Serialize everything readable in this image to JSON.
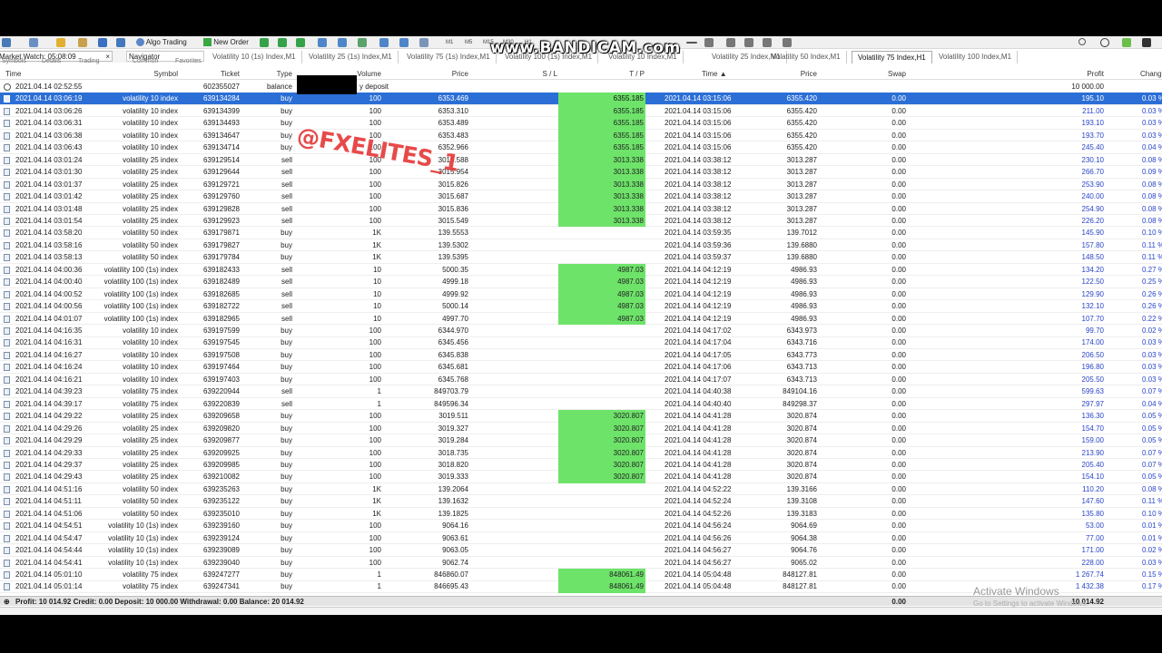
{
  "watermark": "www.BANDICAM.com",
  "toolbar": {
    "algo": "Algo Trading",
    "neworder": "New Order",
    "timeframes": [
      "M1",
      "M5",
      "M15",
      "M30",
      "H1",
      "H4"
    ]
  },
  "panel": {
    "market_watch": "Market Watch: 05:08:09",
    "navigator": "Navigator",
    "tab_symbols": "Symbols",
    "tab_details": "Details",
    "tab_trading": "Trading",
    "tab_common": "Common",
    "tab_favorites": "Favorites"
  },
  "chart_tabs": [
    "Volatility 10 (1s) Index,M1",
    "Volatility 25 (1s) Index,M1",
    "Volatility 75 (1s) Index,M1",
    "Volatility 100 (1s) Index,M1",
    "Volatility 10 Index,M1",
    "Volatility 25 Index,M1",
    "Volatility 50 Index,M1",
    "Volatility 75 Index,H1",
    "Volatility 100 Index,M1"
  ],
  "active_tab": 7,
  "columns": {
    "time": "Time",
    "symbol": "Symbol",
    "ticket": "Ticket",
    "type": "Type",
    "volume": "Volume",
    "price": "Price",
    "sl": "S / L",
    "tp": "T / P",
    "time2": "Time",
    "price2": "Price",
    "swap": "Swap",
    "profit": "Profit",
    "change": "Chang"
  },
  "balance_row": {
    "time": "2021.04.14 02:52:55",
    "ticket": "602355027",
    "type": "balance",
    "comment": "y deposit",
    "profit": "10 000.00"
  },
  "rows": [
    [
      "2021.04.14 03:06:19",
      "volatility 10 index",
      "639134284",
      "buy",
      "100",
      "6353.469",
      "",
      "6355.185",
      "2021.04.14 03:15:06",
      "6355.420",
      "0.00",
      "195.10",
      "0.03 %"
    ],
    [
      "2021.04.14 03:06:26",
      "volatility 10 index",
      "639134399",
      "buy",
      "100",
      "6353.310",
      "",
      "6355.185",
      "2021.04.14 03:15:06",
      "6355.420",
      "0.00",
      "211.00",
      "0.03 %"
    ],
    [
      "2021.04.14 03:06:31",
      "volatility 10 index",
      "639134493",
      "buy",
      "100",
      "6353.489",
      "",
      "6355.185",
      "2021.04.14 03:15:06",
      "6355.420",
      "0.00",
      "193.10",
      "0.03 %"
    ],
    [
      "2021.04.14 03:06:38",
      "volatility 10 index",
      "639134647",
      "buy",
      "100",
      "6353.483",
      "",
      "6355.185",
      "2021.04.14 03:15:06",
      "6355.420",
      "0.00",
      "193.70",
      "0.03 %"
    ],
    [
      "2021.04.14 03:06:43",
      "volatility 10 index",
      "639134714",
      "buy",
      "100",
      "6352.966",
      "",
      "6355.185",
      "2021.04.14 03:15:06",
      "6355.420",
      "0.00",
      "245.40",
      "0.04 %"
    ],
    [
      "2021.04.14 03:01:24",
      "volatility 25 index",
      "639129514",
      "sell",
      "100",
      "3015.588",
      "",
      "3013.338",
      "2021.04.14 03:38:12",
      "3013.287",
      "0.00",
      "230.10",
      "0.08 %"
    ],
    [
      "2021.04.14 03:01:30",
      "volatility 25 index",
      "639129644",
      "sell",
      "100",
      "3015.954",
      "",
      "3013.338",
      "2021.04.14 03:38:12",
      "3013.287",
      "0.00",
      "266.70",
      "0.09 %"
    ],
    [
      "2021.04.14 03:01:37",
      "volatility 25 index",
      "639129721",
      "sell",
      "100",
      "3015.826",
      "",
      "3013.338",
      "2021.04.14 03:38:12",
      "3013.287",
      "0.00",
      "253.90",
      "0.08 %"
    ],
    [
      "2021.04.14 03:01:42",
      "volatility 25 index",
      "639129760",
      "sell",
      "100",
      "3015.687",
      "",
      "3013.338",
      "2021.04.14 03:38:12",
      "3013.287",
      "0.00",
      "240.00",
      "0.08 %"
    ],
    [
      "2021.04.14 03:01:48",
      "volatility 25 index",
      "639129828",
      "sell",
      "100",
      "3015.836",
      "",
      "3013.338",
      "2021.04.14 03:38:12",
      "3013.287",
      "0.00",
      "254.90",
      "0.08 %"
    ],
    [
      "2021.04.14 03:01:54",
      "volatility 25 index",
      "639129923",
      "sell",
      "100",
      "3015.549",
      "",
      "3013.338",
      "2021.04.14 03:38:12",
      "3013.287",
      "0.00",
      "226.20",
      "0.08 %"
    ],
    [
      "2021.04.14 03:58:20",
      "volatility 50 index",
      "639179871",
      "buy",
      "1K",
      "139.5553",
      "",
      "",
      "2021.04.14 03:59:35",
      "139.7012",
      "0.00",
      "145.90",
      "0.10 %"
    ],
    [
      "2021.04.14 03:58:16",
      "volatility 50 index",
      "639179827",
      "buy",
      "1K",
      "139.5302",
      "",
      "",
      "2021.04.14 03:59:36",
      "139.6880",
      "0.00",
      "157.80",
      "0.11 %"
    ],
    [
      "2021.04.14 03:58:13",
      "volatility 50 index",
      "639179784",
      "buy",
      "1K",
      "139.5395",
      "",
      "",
      "2021.04.14 03:59:37",
      "139.6880",
      "0.00",
      "148.50",
      "0.11 %"
    ],
    [
      "2021.04.14 04:00:36",
      "volatility 100 (1s) index",
      "639182433",
      "sell",
      "10",
      "5000.35",
      "",
      "4987.03",
      "2021.04.14 04:12:19",
      "4986.93",
      "0.00",
      "134.20",
      "0.27 %"
    ],
    [
      "2021.04.14 04:00:40",
      "volatility 100 (1s) index",
      "639182489",
      "sell",
      "10",
      "4999.18",
      "",
      "4987.03",
      "2021.04.14 04:12:19",
      "4986.93",
      "0.00",
      "122.50",
      "0.25 %"
    ],
    [
      "2021.04.14 04:00:52",
      "volatility 100 (1s) index",
      "639182685",
      "sell",
      "10",
      "4999.92",
      "",
      "4987.03",
      "2021.04.14 04:12:19",
      "4986.93",
      "0.00",
      "129.90",
      "0.26 %"
    ],
    [
      "2021.04.14 04:00:56",
      "volatility 100 (1s) index",
      "639182722",
      "sell",
      "10",
      "5000.14",
      "",
      "4987.03",
      "2021.04.14 04:12:19",
      "4986.93",
      "0.00",
      "132.10",
      "0.26 %"
    ],
    [
      "2021.04.14 04:01:07",
      "volatility 100 (1s) index",
      "639182965",
      "sell",
      "10",
      "4997.70",
      "",
      "4987.03",
      "2021.04.14 04:12:19",
      "4986.93",
      "0.00",
      "107.70",
      "0.22 %"
    ],
    [
      "2021.04.14 04:16:35",
      "volatility 10 index",
      "639197599",
      "buy",
      "100",
      "6344.970",
      "",
      "",
      "2021.04.14 04:17:02",
      "6343.973",
      "0.00",
      "99.70",
      "0.02 %"
    ],
    [
      "2021.04.14 04:16:31",
      "volatility 10 index",
      "639197545",
      "buy",
      "100",
      "6345.456",
      "",
      "",
      "2021.04.14 04:17:04",
      "6343.716",
      "0.00",
      "174.00",
      "0.03 %"
    ],
    [
      "2021.04.14 04:16:27",
      "volatility 10 index",
      "639197508",
      "buy",
      "100",
      "6345.838",
      "",
      "",
      "2021.04.14 04:17:05",
      "6343.773",
      "0.00",
      "206.50",
      "0.03 %"
    ],
    [
      "2021.04.14 04:16:24",
      "volatility 10 index",
      "639197464",
      "buy",
      "100",
      "6345.681",
      "",
      "",
      "2021.04.14 04:17:06",
      "6343.713",
      "0.00",
      "196.80",
      "0.03 %"
    ],
    [
      "2021.04.14 04:16:21",
      "volatility 10 index",
      "639197403",
      "buy",
      "100",
      "6345.768",
      "",
      "",
      "2021.04.14 04:17:07",
      "6343.713",
      "0.00",
      "205.50",
      "0.03 %"
    ],
    [
      "2021.04.14 04:39:23",
      "volatility 75 index",
      "639220944",
      "sell",
      "1",
      "849703.79",
      "",
      "",
      "2021.04.14 04:40:38",
      "849104.16",
      "0.00",
      "599.63",
      "0.07 %"
    ],
    [
      "2021.04.14 04:39:17",
      "volatility 75 index",
      "639220839",
      "sell",
      "1",
      "849596.34",
      "",
      "",
      "2021.04.14 04:40:40",
      "849298.37",
      "0.00",
      "297.97",
      "0.04 %"
    ],
    [
      "2021.04.14 04:29:22",
      "volatility 25 index",
      "639209658",
      "buy",
      "100",
      "3019.511",
      "",
      "3020.807",
      "2021.04.14 04:41:28",
      "3020.874",
      "0.00",
      "136.30",
      "0.05 %"
    ],
    [
      "2021.04.14 04:29:26",
      "volatility 25 index",
      "639209820",
      "buy",
      "100",
      "3019.327",
      "",
      "3020.807",
      "2021.04.14 04:41:28",
      "3020.874",
      "0.00",
      "154.70",
      "0.05 %"
    ],
    [
      "2021.04.14 04:29:29",
      "volatility 25 index",
      "639209877",
      "buy",
      "100",
      "3019.284",
      "",
      "3020.807",
      "2021.04.14 04:41:28",
      "3020.874",
      "0.00",
      "159.00",
      "0.05 %"
    ],
    [
      "2021.04.14 04:29:33",
      "volatility 25 index",
      "639209925",
      "buy",
      "100",
      "3018.735",
      "",
      "3020.807",
      "2021.04.14 04:41:28",
      "3020.874",
      "0.00",
      "213.90",
      "0.07 %"
    ],
    [
      "2021.04.14 04:29:37",
      "volatility 25 index",
      "639209985",
      "buy",
      "100",
      "3018.820",
      "",
      "3020.807",
      "2021.04.14 04:41:28",
      "3020.874",
      "0.00",
      "205.40",
      "0.07 %"
    ],
    [
      "2021.04.14 04:29:43",
      "volatility 25 index",
      "639210082",
      "buy",
      "100",
      "3019.333",
      "",
      "3020.807",
      "2021.04.14 04:41:28",
      "3020.874",
      "0.00",
      "154.10",
      "0.05 %"
    ],
    [
      "2021.04.14 04:51:16",
      "volatility 50 index",
      "639235263",
      "buy",
      "1K",
      "139.2064",
      "",
      "",
      "2021.04.14 04:52:22",
      "139.3166",
      "0.00",
      "110.20",
      "0.08 %"
    ],
    [
      "2021.04.14 04:51:11",
      "volatility 50 index",
      "639235122",
      "buy",
      "1K",
      "139.1632",
      "",
      "",
      "2021.04.14 04:52:24",
      "139.3108",
      "0.00",
      "147.60",
      "0.11 %"
    ],
    [
      "2021.04.14 04:51:06",
      "volatility 50 index",
      "639235010",
      "buy",
      "1K",
      "139.1825",
      "",
      "",
      "2021.04.14 04:52:26",
      "139.3183",
      "0.00",
      "135.80",
      "0.10 %"
    ],
    [
      "2021.04.14 04:54:51",
      "volatility 10 (1s) index",
      "639239160",
      "buy",
      "100",
      "9064.16",
      "",
      "",
      "2021.04.14 04:56:24",
      "9064.69",
      "0.00",
      "53.00",
      "0.01 %"
    ],
    [
      "2021.04.14 04:54:47",
      "volatility 10 (1s) index",
      "639239124",
      "buy",
      "100",
      "9063.61",
      "",
      "",
      "2021.04.14 04:56:26",
      "9064.38",
      "0.00",
      "77.00",
      "0.01 %"
    ],
    [
      "2021.04.14 04:54:44",
      "volatility 10 (1s) index",
      "639239089",
      "buy",
      "100",
      "9063.05",
      "",
      "",
      "2021.04.14 04:56:27",
      "9064.76",
      "0.00",
      "171.00",
      "0.02 %"
    ],
    [
      "2021.04.14 04:54:41",
      "volatility 10 (1s) index",
      "639239040",
      "buy",
      "100",
      "9062.74",
      "",
      "",
      "2021.04.14 04:56:27",
      "9065.02",
      "0.00",
      "228.00",
      "0.03 %"
    ],
    [
      "2021.04.14 05:01:10",
      "volatility 75 index",
      "639247277",
      "buy",
      "1",
      "846860.07",
      "",
      "848061.49",
      "2021.04.14 05:04:48",
      "848127.81",
      "0.00",
      "1 267.74",
      "0.15 %"
    ],
    [
      "2021.04.14 05:01:14",
      "volatility 75 index",
      "639247341",
      "buy",
      "1",
      "846695.43",
      "",
      "848061.49",
      "2021.04.14 05:04:48",
      "848127.81",
      "0.00",
      "1 432.38",
      "0.17 %"
    ]
  ],
  "selected_row": 0,
  "footer": {
    "summary": "Profit: 10 014.92  Credit: 0.00  Deposit: 10 000.00  Withdrawal: 0.00  Balance: 20 014.92",
    "swap": "0.00",
    "profit": "10 014.92"
  },
  "stamp": "@FXELITES_1",
  "activate": {
    "title": "Activate Windows",
    "sub": "Go to Settings to activate Windows."
  },
  "colors": {
    "selection": "#2b6fd6",
    "tp_highlight": "#6ee36a",
    "profit_text": "#2944c9"
  }
}
